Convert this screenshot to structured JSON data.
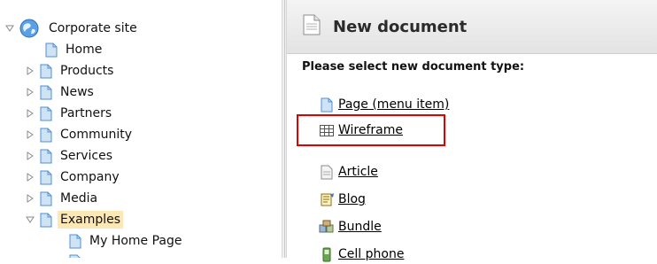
{
  "tree": {
    "root": {
      "label": "Corporate site"
    },
    "items": [
      {
        "label": "Home"
      },
      {
        "label": "Products"
      },
      {
        "label": "News"
      },
      {
        "label": "Partners"
      },
      {
        "label": "Community"
      },
      {
        "label": "Services"
      },
      {
        "label": "Company"
      },
      {
        "label": "Media"
      },
      {
        "label": "Examples"
      },
      {
        "label": "My Home Page"
      }
    ]
  },
  "panel": {
    "title": "New document",
    "prompt": "Please select new document type:",
    "types": [
      {
        "label": "Page (menu item)",
        "icon": "page-icon"
      },
      {
        "label": "Wireframe",
        "icon": "wireframe-icon"
      },
      {
        "label": "Article",
        "icon": "article-icon"
      },
      {
        "label": "Blog",
        "icon": "blog-icon"
      },
      {
        "label": "Bundle",
        "icon": "bundle-icon"
      },
      {
        "label": "Cell phone",
        "icon": "cell-phone-icon"
      }
    ]
  },
  "colors": {
    "selection": "#fde7b4",
    "highlight_border": "#e00000",
    "doc_icon_blue": "#4f8fd6"
  }
}
